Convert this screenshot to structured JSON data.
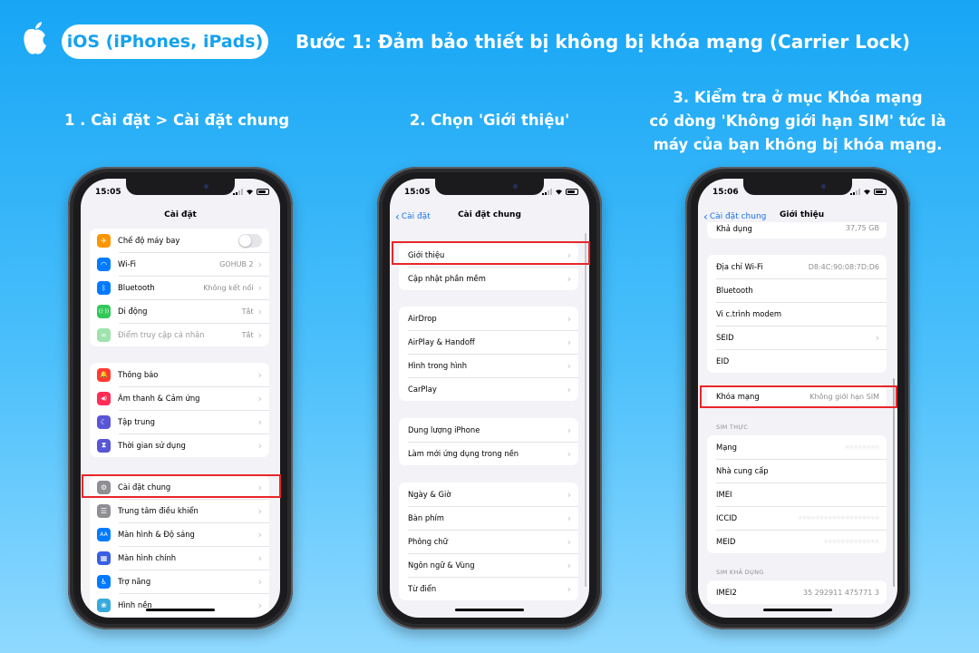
{
  "header": {
    "platform_pill": "iOS (iPhones, iPads)",
    "headline": "Bước 1: Đảm bảo thiết bị không bị khóa mạng (Carrier Lock)"
  },
  "steps": {
    "step1": "1 . Cài đặt > Cài đặt chung",
    "step2": "2. Chọn 'Giới thiệu'",
    "step3_line1": "3. Kiểm tra ở mục Khóa mạng",
    "step3_line2": "có dòng 'Không giới hạn SIM' tức là",
    "step3_line3": "máy của bạn không bị khóa mạng."
  },
  "phone1": {
    "time": "15:05",
    "title": "Cài đặt",
    "group1": [
      {
        "label": "Chế độ máy bay",
        "value": "",
        "icon": "airplane-icon",
        "color": "#ff9500",
        "glyph": "✈"
      },
      {
        "label": "Wi-Fi",
        "value": "GOHUB 2",
        "icon": "wifi-icon",
        "color": "#007aff",
        "glyph": "◠"
      },
      {
        "label": "Bluetooth",
        "value": "Không kết nối",
        "icon": "bluetooth-icon",
        "color": "#007aff",
        "glyph": "ᛒ"
      },
      {
        "label": "Di động",
        "value": "Tắt",
        "icon": "cellular-icon",
        "color": "#34c759",
        "glyph": "((·))"
      },
      {
        "label": "Điểm truy cập cá nhân",
        "value": "Tắt",
        "icon": "hotspot-icon",
        "color": "#9ee3ae",
        "glyph": "∞"
      }
    ],
    "group2": [
      {
        "label": "Thông báo",
        "icon": "notification-bell-icon",
        "color": "#ff3b30",
        "glyph": "🔔"
      },
      {
        "label": "Âm thanh & Cảm ứng",
        "icon": "speaker-icon",
        "color": "#ff2d55",
        "glyph": "◀)"
      },
      {
        "label": "Tập trung",
        "icon": "moon-icon",
        "color": "#5856d6",
        "glyph": "☾"
      },
      {
        "label": "Thời gian sử dụng",
        "icon": "hourglass-icon",
        "color": "#5856d6",
        "glyph": "⧗"
      }
    ],
    "group3": [
      {
        "label": "Cài đặt chung",
        "icon": "gear-icon",
        "color": "#8e8e93",
        "glyph": "⚙"
      },
      {
        "label": "Trung tâm điều khiển",
        "icon": "control-center-icon",
        "color": "#8e8e93",
        "glyph": "☰"
      },
      {
        "label": "Màn hình & Độ sáng",
        "icon": "display-brightness-icon",
        "color": "#007aff",
        "glyph": "AA"
      },
      {
        "label": "Màn hình chính",
        "icon": "home-screen-icon",
        "color": "#3a5fe5",
        "glyph": "▦"
      },
      {
        "label": "Trợ năng",
        "icon": "accessibility-icon",
        "color": "#007aff",
        "glyph": "♿"
      },
      {
        "label": "Hình nền",
        "icon": "wallpaper-icon",
        "color": "#36aadc",
        "glyph": "❀"
      }
    ]
  },
  "phone2": {
    "time": "15:05",
    "back": "Cài đặt",
    "title": "Cài đặt chung",
    "group1": [
      "Giới thiệu",
      "Cập nhật phần mềm"
    ],
    "group2": [
      "AirDrop",
      "AirPlay & Handoff",
      "Hình trong hình",
      "CarPlay"
    ],
    "group3": [
      "Dung lượng iPhone",
      "Làm mới ứng dụng trong nền"
    ],
    "group4": [
      "Ngày & Giờ",
      "Bàn phím",
      "Phông chữ",
      "Ngôn ngữ & Vùng",
      "Từ điển"
    ]
  },
  "phone3": {
    "time": "15:06",
    "back": "Cài đặt chung",
    "title": "Giới thiệu",
    "top_row": {
      "label": "Khả dụng",
      "value": "37,75 GB"
    },
    "group1": [
      {
        "label": "Địa chỉ Wi-Fi",
        "value": "D8:4C:90:08:7D:D6"
      },
      {
        "label": "Bluetooth",
        "value": ""
      },
      {
        "label": "Vi c.trình modem",
        "value": ""
      },
      {
        "label": "SEID",
        "value": ""
      },
      {
        "label": "EID",
        "value": ""
      }
    ],
    "carrier_lock": {
      "label": "Khóa mạng",
      "value": "Không giới hạn SIM"
    },
    "sim_physical_header": "SIM THỰC",
    "group2": [
      "Mạng",
      "Nhà cung cấp",
      "IMEI",
      "ICCID",
      "MEID"
    ],
    "sim_available_header": "SIM KHẢ DỤNG",
    "imei2": {
      "label": "IMEI2",
      "value": "35 292911 475771 3"
    }
  }
}
